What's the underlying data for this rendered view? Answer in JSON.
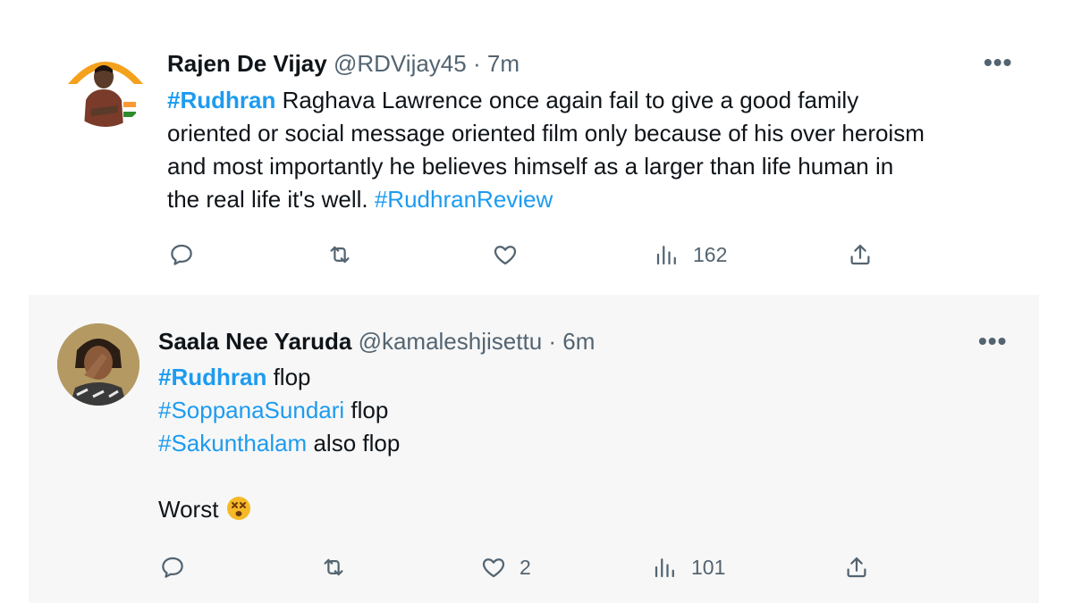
{
  "colors": {
    "text": "#0f1419",
    "secondary": "#536471",
    "link": "#1d9bf0"
  },
  "tweets": [
    {
      "author": {
        "name": "Rajen De Vijay",
        "handle": "@RDVijay45",
        "time": "7m"
      },
      "separator": "·",
      "lines": [
        {
          "tag": "#Rudhran",
          "text": " Raghava Lawrence once again fail to give a good family"
        },
        {
          "text": "oriented or social message oriented film only because of his over heroism"
        },
        {
          "text": "and most importantly he believes himself as a larger than life human in"
        },
        {
          "text": "the real life it's well. ",
          "tag2": "#RudhranReview"
        }
      ],
      "actions": {
        "reply": "",
        "retweet": "",
        "like": "",
        "views": "162",
        "share": ""
      },
      "icons": [
        "reply-icon",
        "retweet-icon",
        "like-icon",
        "views-icon",
        "share-icon",
        "more-icon"
      ]
    },
    {
      "author": {
        "name": "Saala Nee Yaruda",
        "handle": "@kamaleshjisettu",
        "time": "6m"
      },
      "separator": "·",
      "lines": [
        {
          "tag": "#Rudhran",
          "text": " flop"
        },
        {
          "tag": "#SoppanaSundari",
          "text": " flop"
        },
        {
          "tag": "#Sakunthalam",
          "text": " also flop"
        },
        {
          "text": "Worst",
          "emoji": "dizzy-face-emoji"
        }
      ],
      "actions": {
        "reply": "",
        "retweet": "",
        "like": "2",
        "views": "101",
        "share": ""
      },
      "icons": [
        "reply-icon",
        "retweet-icon",
        "like-icon",
        "views-icon",
        "share-icon",
        "more-icon"
      ]
    }
  ]
}
